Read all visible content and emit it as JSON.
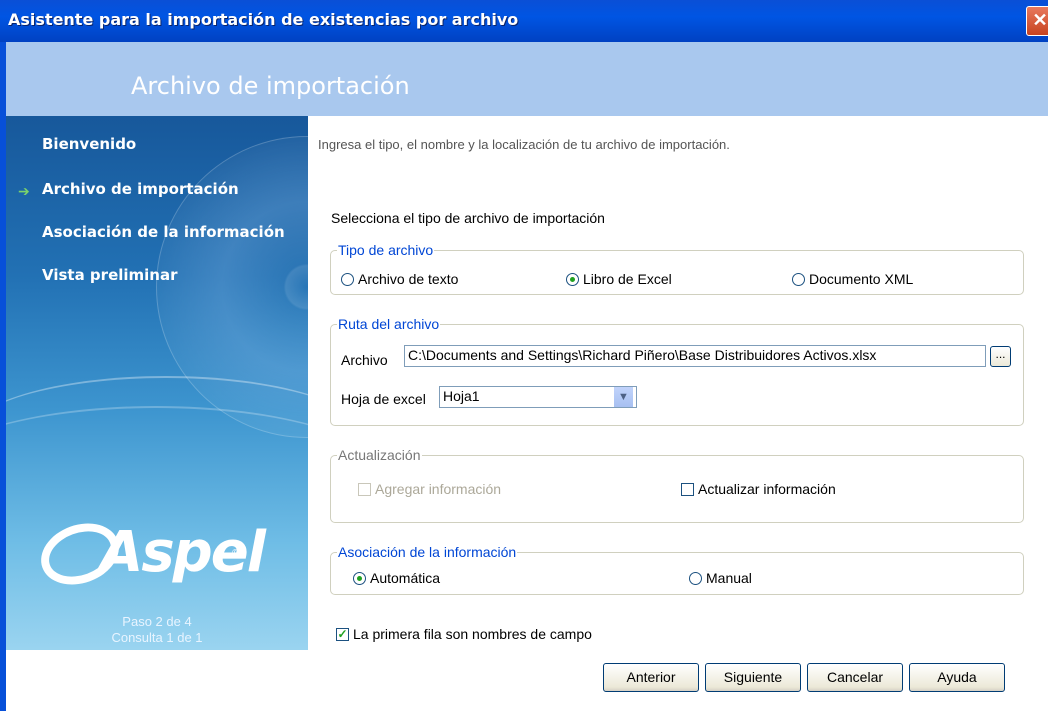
{
  "window": {
    "title": "Asistente para la importación de existencias por archivo",
    "close_glyph": "✕"
  },
  "header": {
    "title": "Archivo de importación"
  },
  "sidebar": {
    "steps": [
      {
        "label": "Bienvenido"
      },
      {
        "label": "Archivo de importación",
        "current": true
      },
      {
        "label": "Asociación de la información"
      },
      {
        "label": "Vista preliminar"
      }
    ],
    "logo": "Aspel",
    "logo_reg": "®",
    "paso": "Paso 2 de 4",
    "consulta": "Consulta 1 de 1"
  },
  "main": {
    "intro": "Ingresa el tipo, el nombre y la localización de tu archivo de importación.",
    "select_label": "Selecciona el tipo de archivo de importación",
    "tipo": {
      "legend": "Tipo de archivo",
      "options": [
        {
          "label": "Archivo de texto",
          "selected": false
        },
        {
          "label": "Libro de Excel",
          "selected": true
        },
        {
          "label": "Documento XML",
          "selected": false
        }
      ]
    },
    "ruta": {
      "legend": "Ruta del archivo",
      "archivo_label": "Archivo",
      "archivo_value": "C:\\Documents and Settings\\Richard Piñero\\Base Distribuidores Activos.xlsx",
      "browse_label": "...",
      "hoja_label": "Hoja de excel",
      "hoja_value": "Hoja1"
    },
    "actualizacion": {
      "legend": "Actualización",
      "agregar": {
        "label": "Agregar información",
        "checked": false,
        "enabled": false
      },
      "actualizar": {
        "label": "Actualizar información",
        "checked": false,
        "enabled": true
      }
    },
    "asociacion": {
      "legend": "Asociación de la información",
      "options": [
        {
          "label": "Automática",
          "selected": true
        },
        {
          "label": "Manual",
          "selected": false
        }
      ]
    },
    "primera_fila": {
      "label": "La primera fila son nombres de campo",
      "checked": true
    }
  },
  "buttons": {
    "anterior": "Anterior",
    "siguiente": "Siguiente",
    "cancelar": "Cancelar",
    "ayuda": "Ayuda"
  },
  "colors": {
    "titlebar": "#0055e3",
    "header": "#a9c8ee",
    "legend": "#0046d5"
  }
}
